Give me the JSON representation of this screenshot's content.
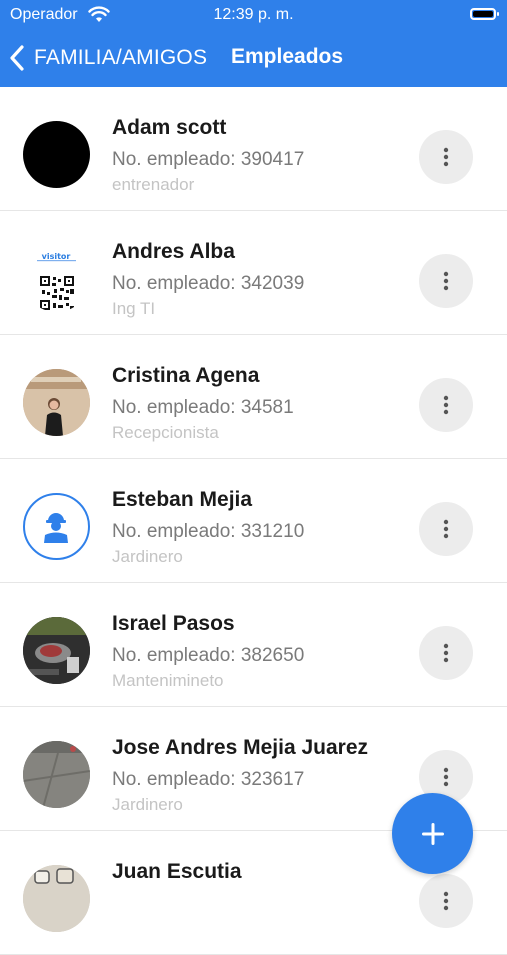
{
  "status_bar": {
    "carrier": "Operador",
    "time": "12:39 p. m."
  },
  "nav": {
    "back_label": "FAMILIA/AMIGOS",
    "title": "Empleados"
  },
  "employees": [
    {
      "name": "Adam scott",
      "employee_number": "No. empleado: 390417",
      "role": "entrenador",
      "avatar": "black-circle"
    },
    {
      "name": "Andres Alba",
      "employee_number": "No. empleado: 342039",
      "role": "Ing TI",
      "avatar": "visitor-qr-code"
    },
    {
      "name": "Cristina Agena",
      "employee_number": "No. empleado: 34581",
      "role": "Recepcionista",
      "avatar": "person-photo"
    },
    {
      "name": "Esteban Mejia",
      "employee_number": "No. empleado: 331210",
      "role": "Jardinero",
      "avatar": "worker-icon"
    },
    {
      "name": "Israel Pasos",
      "employee_number": "No. empleado: 382650",
      "role": "Mantenimineto",
      "avatar": "food-photo"
    },
    {
      "name": "Jose Andres Mejia Juarez",
      "employee_number": "No. empleado: 323617",
      "role": "Jardinero",
      "avatar": "floor-photo"
    },
    {
      "name": "Juan Escutia",
      "employee_number": "",
      "role": "",
      "avatar": "photo"
    }
  ],
  "fab": {
    "icon": "plus-icon"
  },
  "colors": {
    "primary": "#2f80ea",
    "more_button_bg": "#ececec"
  }
}
